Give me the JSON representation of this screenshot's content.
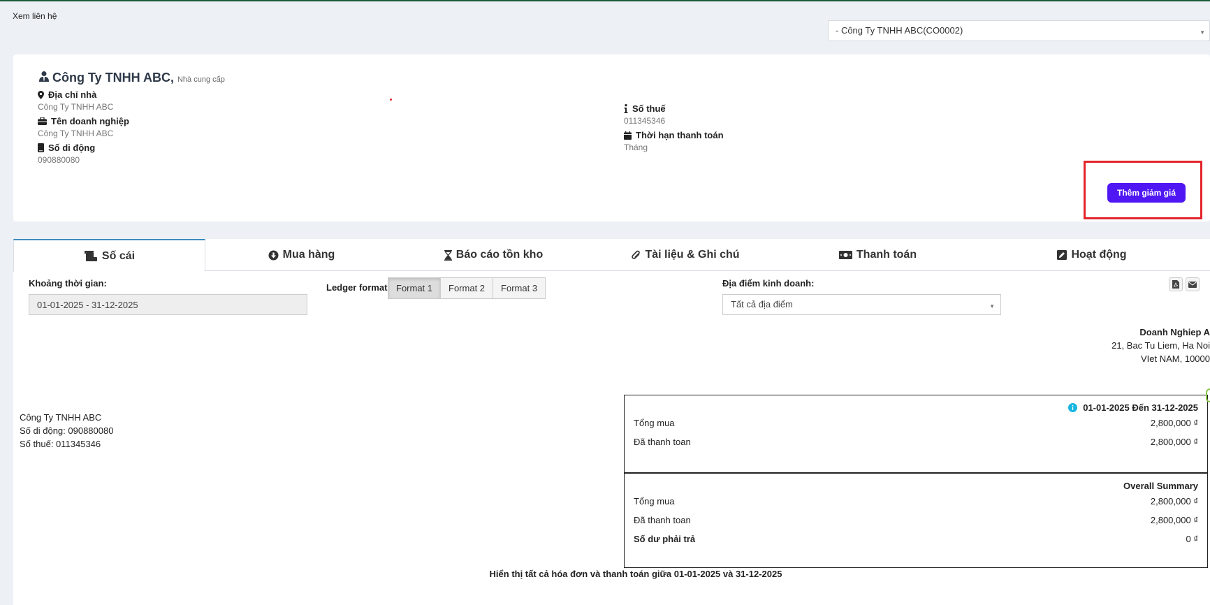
{
  "breadcrumb": "Xem liên hệ",
  "contact_select": {
    "value": "- Công Ty TNHH ABC(CO0002)"
  },
  "contact": {
    "name": "Công Ty TNHH ABC,",
    "role": "Nhà cung cấp",
    "address_label": "Địa chỉ nhà",
    "address_value": "Công Ty TNHH ABC",
    "business_label": "Tên doanh nghiệp",
    "business_value": "Công Ty TNHH ABC",
    "mobile_label": "Số di động",
    "mobile_value": "090880080",
    "tax_label": "Số thuế",
    "tax_value": "011345346",
    "term_label": "Thời hạn thanh toán",
    "term_value": "Tháng"
  },
  "discount_button": "Thêm giảm giá",
  "tabs": [
    {
      "label": "Số cái",
      "icon": "ledger-icon",
      "active": true
    },
    {
      "label": "Mua hàng",
      "icon": "arrow-circle-down-icon",
      "active": false
    },
    {
      "label": "Báo cáo tồn kho",
      "icon": "hourglass-icon",
      "active": false
    },
    {
      "label": "Tài liệu & Ghi chú",
      "icon": "paperclip-icon",
      "active": false
    },
    {
      "label": "Thanh toán",
      "icon": "money-icon",
      "active": false
    },
    {
      "label": "Hoạt động",
      "icon": "edit-icon",
      "active": false
    }
  ],
  "filters": {
    "date_range_label": "Khoảng thời gian:",
    "date_range_value": "01-01-2025 - 31-12-2025",
    "ledger_format_label": "Ledger format",
    "formats": [
      "Format 1",
      "Format 2",
      "Format 3"
    ],
    "active_format": "Format 1",
    "location_label": "Địa điểm kinh doanh:",
    "location_value": "Tất cả địa điểm"
  },
  "business": {
    "name": "Doanh Nghiep A",
    "address_line1": "21, Bac Tu Liem, Ha Noi",
    "address_line2": "VIet NAM, 10000"
  },
  "supplier_block": {
    "name": "Công Ty TNHH ABC",
    "mobile": "Số di động: 090880080",
    "tax": "Số thuế: 011345346"
  },
  "summary_period": {
    "header": "01-01-2025 Đến 31-12-2025",
    "rows": [
      {
        "label": "Tổng mua",
        "value": "2,800,000 ₫"
      },
      {
        "label": "Đã thanh toan",
        "value": "2,800,000 ₫"
      }
    ]
  },
  "summary_overall": {
    "header": "Overall Summary",
    "rows": [
      {
        "label": "Tổng mua",
        "value": "2,800,000 ₫"
      },
      {
        "label": "Đã thanh toan",
        "value": "2,800,000 ₫"
      }
    ],
    "balance_label": "Số dư phải trả",
    "balance_value": "0 ₫"
  },
  "footer_note": "Hiển thị tất cả hóa đơn và thanh toán giữa 01-01-2025 và 31-12-2025",
  "colors": {
    "accent_button": "#4f17f3",
    "highlight_border": "#e3242b",
    "active_tab_border": "#3c8dbc",
    "info_icon": "#17b6e0"
  }
}
